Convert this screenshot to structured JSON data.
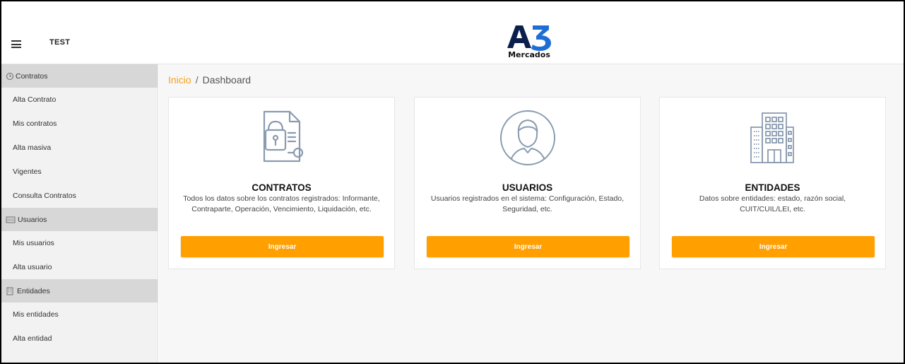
{
  "header": {
    "env_label": "TEST",
    "logo_text": "Mercados",
    "logo_mark": "A3",
    "menu_icon": "hamburger-icon"
  },
  "sidebar": {
    "sections": [
      {
        "label": "Contratos",
        "icon": "clock-icon",
        "items": [
          "Alta Contrato",
          "Mis contratos",
          "Alta masiva",
          "Vigentes",
          "Consulta Contratos"
        ]
      },
      {
        "label": "Usuarios",
        "icon": "users-icon",
        "items": [
          "Mis usuarios",
          "Alta usuario"
        ]
      },
      {
        "label": "Entidades",
        "icon": "building-icon",
        "items": [
          "Mis entidades",
          "Alta entidad"
        ]
      }
    ]
  },
  "breadcrumb": {
    "home": "Inicio",
    "separator": "/",
    "current": "Dashboard"
  },
  "cards": [
    {
      "title": "CONTRATOS",
      "desc": "Todos los datos sobre los contratos registrados: Informante, Contraparte, Operación, Vencimiento, Liquidación, etc.",
      "button": "Ingresar",
      "icon": "contract-icon"
    },
    {
      "title": "USUARIOS",
      "desc": "Usuarios registrados en el sistema: Configuración, Estado, Seguridad, etc.",
      "button": "Ingresar",
      "icon": "user-icon"
    },
    {
      "title": "ENTIDADES",
      "desc": "Datos sobre entidades: estado, razón social, CUIT/CUIL/LEI, etc.",
      "button": "Ingresar",
      "icon": "building-icon"
    }
  ],
  "colors": {
    "accent": "#ff9f00",
    "breadcrumb_home": "#f7a11a",
    "logo_blue": "#1d6fd6",
    "logo_dark": "#0b1f4d",
    "icon_stroke": "#8a9bb0"
  }
}
